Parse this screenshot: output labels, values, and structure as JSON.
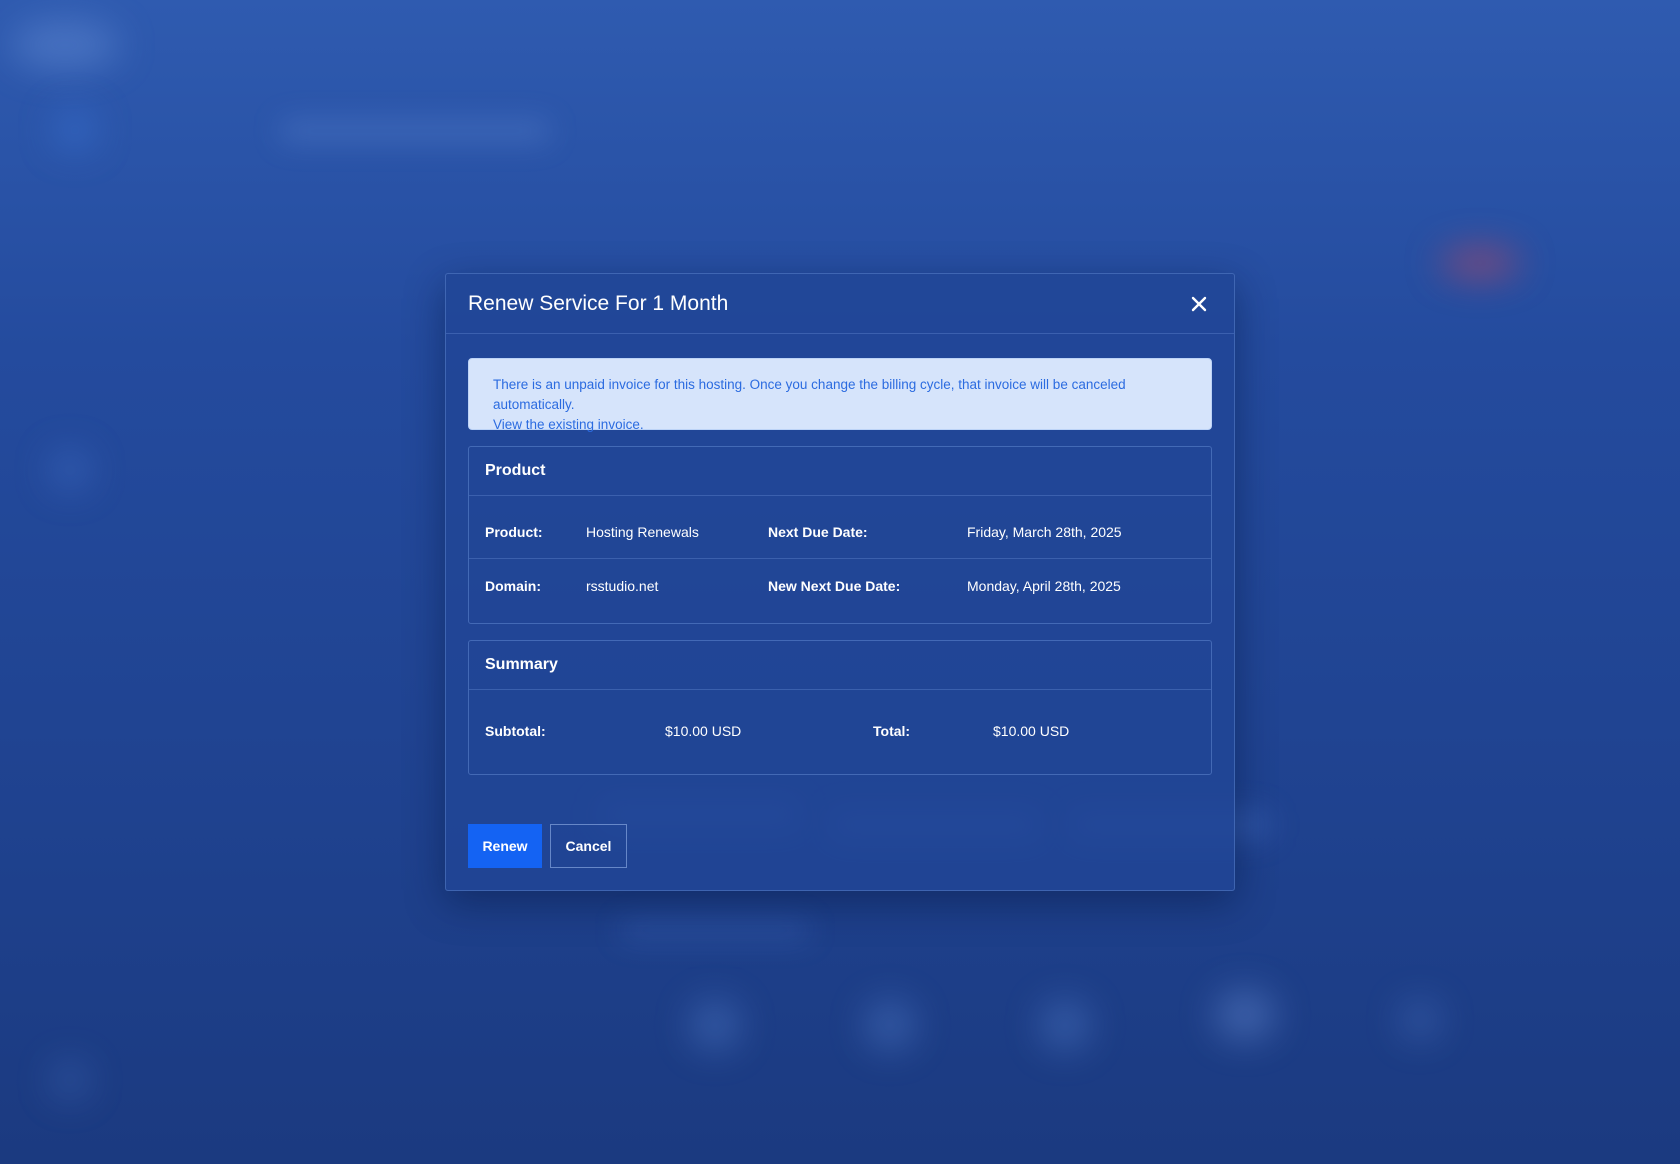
{
  "modal": {
    "title": "Renew Service For 1 Month",
    "close_icon": "close-icon"
  },
  "alert": {
    "line1": "There is an unpaid invoice for this hosting. Once you change the billing cycle, that invoice will be canceled automatically.",
    "link": "View the existing invoice."
  },
  "product": {
    "heading": "Product",
    "rows": [
      {
        "label": "Product:",
        "value": "Hosting Renewals",
        "label2": "Next Due Date:",
        "value2": "Friday, March 28th, 2025"
      },
      {
        "label": "Domain:",
        "value": "rsstudio.net",
        "label2": "New Next Due Date:",
        "value2": "Monday, April 28th, 2025"
      }
    ]
  },
  "summary": {
    "heading": "Summary",
    "subtotal_label": "Subtotal:",
    "subtotal_value": "$10.00 USD",
    "total_label": "Total:",
    "total_value": "$10.00 USD"
  },
  "actions": {
    "renew_label": "Renew",
    "cancel_label": "Cancel"
  },
  "colors": {
    "primary": "#1463f3",
    "alert_bg": "#d6e4fb",
    "alert_text": "#2b6be0"
  }
}
